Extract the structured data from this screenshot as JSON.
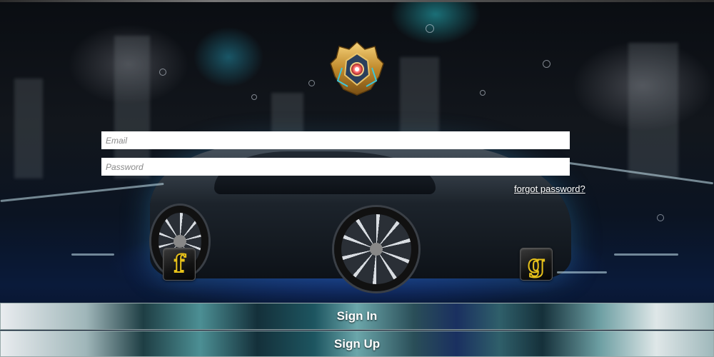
{
  "login": {
    "email_placeholder": "Email",
    "password_placeholder": "Password",
    "forgot_password": "forgot password?",
    "signin_label": "Sign In",
    "signup_label": "Sign Up"
  },
  "social": {
    "facebook_glyph": "f",
    "google_glyph": "g"
  },
  "icons": {
    "emblem": "league-emblem-icon",
    "facebook": "facebook-icon",
    "google": "google-icon"
  },
  "colors": {
    "social_accent": "#e8c21a",
    "input_background": "#ffffff",
    "link_text": "#ffffff"
  }
}
